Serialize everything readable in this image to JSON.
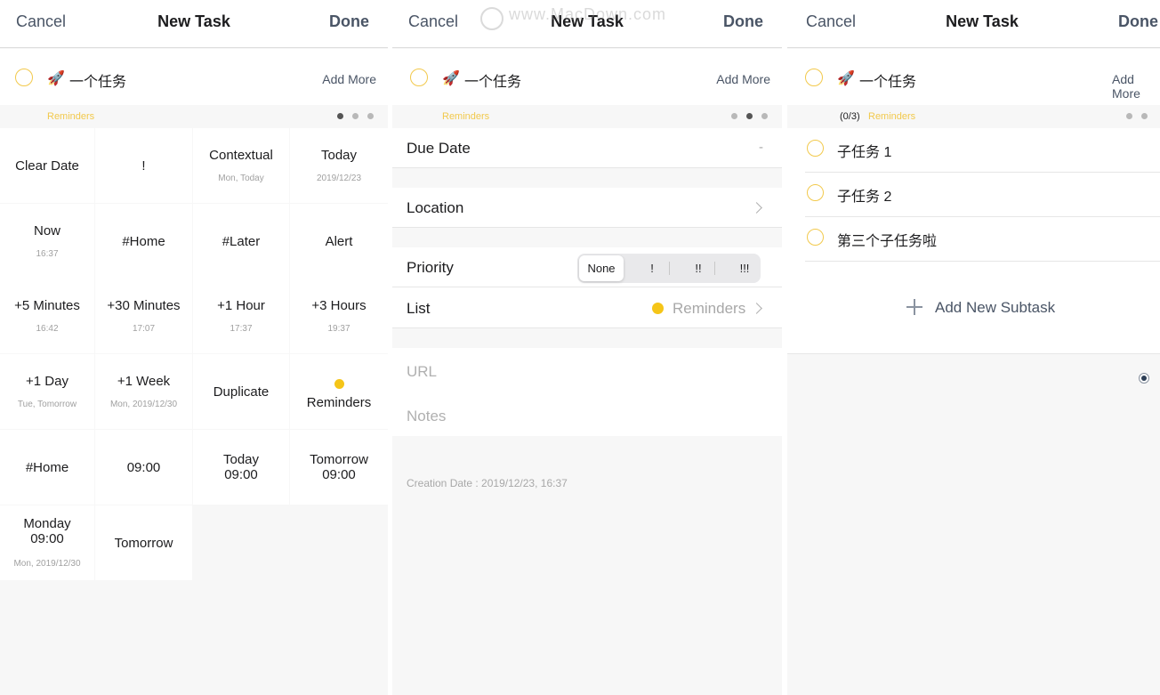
{
  "nav": {
    "cancel": "Cancel",
    "title": "New Task",
    "done": "Done"
  },
  "task": {
    "emoji": "🚀",
    "name": "一个任务",
    "add_more": "Add More"
  },
  "list_name": "Reminders",
  "subtask_count": "(0/3)",
  "colors": {
    "accent": "#f5c518",
    "circle": "#f2c94c",
    "text_link": "#4a5566"
  },
  "quick_actions": [
    {
      "main": "Clear Date",
      "sub": ""
    },
    {
      "main": "!",
      "sub": ""
    },
    {
      "main": "Contextual",
      "sub": "Mon, Today"
    },
    {
      "main": "Today",
      "sub": "2019/12/23"
    },
    {
      "main": "Now",
      "sub": "16:37"
    },
    {
      "main": "#Home",
      "sub": ""
    },
    {
      "main": "#Later",
      "sub": ""
    },
    {
      "main": "Alert",
      "sub": ""
    },
    {
      "main": "+5 Minutes",
      "sub": "16:42"
    },
    {
      "main": "+30 Minutes",
      "sub": "17:07"
    },
    {
      "main": "+1 Hour",
      "sub": "17:37"
    },
    {
      "main": "+3 Hours",
      "sub": "19:37"
    },
    {
      "main": "+1 Day",
      "sub": "Tue, Tomorrow"
    },
    {
      "main": "+1 Week",
      "sub": "Mon, 2019/12/30"
    },
    {
      "main": "Duplicate",
      "sub": ""
    },
    {
      "main": "Reminders",
      "sub": ""
    },
    {
      "main": "#Home",
      "sub": ""
    },
    {
      "main": "09:00",
      "sub": ""
    },
    {
      "main": "Today\n09:00",
      "sub": ""
    },
    {
      "main": "Tomorrow\n09:00",
      "sub": ""
    },
    {
      "main": "Monday\n09:00",
      "sub": "Mon, 2019/12/30"
    },
    {
      "main": "Tomorrow",
      "sub": ""
    }
  ],
  "details": {
    "due_date_label": "Due Date",
    "due_date_value": "-",
    "location_label": "Location",
    "priority_label": "Priority",
    "priority_options": [
      "None",
      "!",
      "!!",
      "!!!"
    ],
    "priority_selected": "None",
    "list_label": "List",
    "list_value": "Reminders",
    "url_placeholder": "URL",
    "notes_placeholder": "Notes",
    "creation_date": "Creation Date : 2019/12/23, 16:37"
  },
  "subtasks": {
    "items": [
      "子任务 1",
      "子任务 2",
      "第三个子任务啦"
    ],
    "add_label": "Add New Subtask"
  },
  "watermark": "www.MacDown.com"
}
